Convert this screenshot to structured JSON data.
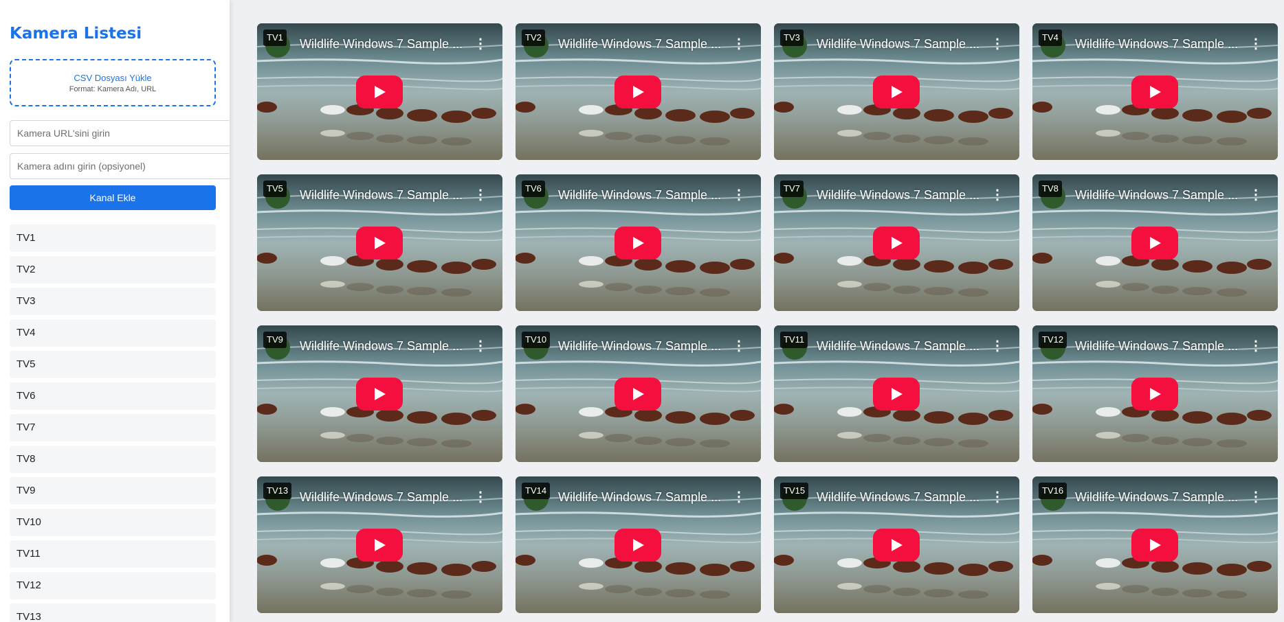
{
  "sidebar": {
    "title": "Kamera Listesi",
    "upload": {
      "label": "CSV Dosyası Yükle",
      "format": "Format: Kamera Adı, URL"
    },
    "url_placeholder": "Kamera URL'sini girin",
    "name_placeholder": "Kamera adını girin (opsiyonel)",
    "add_button": "Kanal Ekle",
    "channels": [
      "TV1",
      "TV2",
      "TV3",
      "TV4",
      "TV5",
      "TV6",
      "TV7",
      "TV8",
      "TV9",
      "TV10",
      "TV11",
      "TV12",
      "TV13"
    ]
  },
  "player": {
    "video_title": "Wildlife Windows 7 Sample ...",
    "tiles": [
      "TV1",
      "TV2",
      "TV3",
      "TV4",
      "TV5",
      "TV6",
      "TV7",
      "TV8",
      "TV9",
      "TV10",
      "TV11",
      "TV12",
      "TV13",
      "TV14",
      "TV15",
      "TV16"
    ]
  },
  "colors": {
    "accent": "#1a73e8",
    "play_button": "#f40f3e",
    "background": "#eef0f4"
  }
}
